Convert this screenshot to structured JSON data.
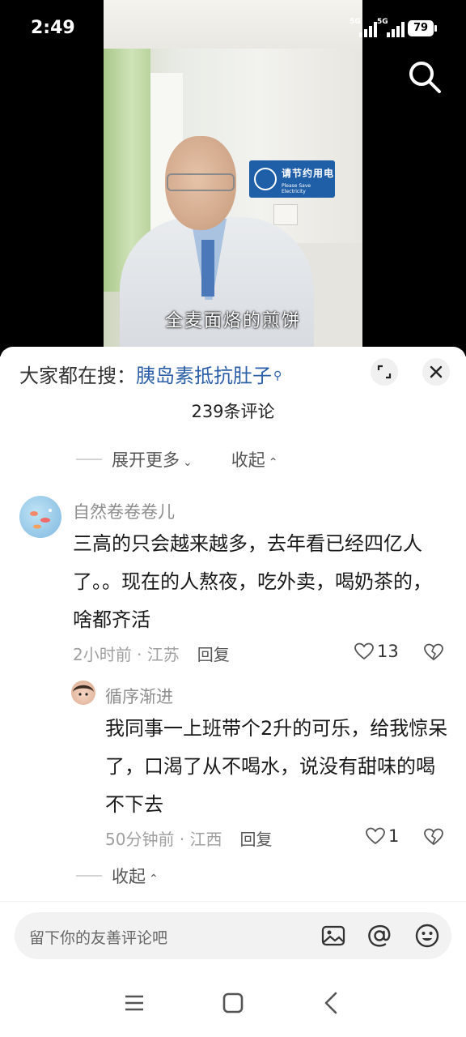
{
  "status_bar": {
    "time": "2:49",
    "network_1": "5G",
    "network_2": "5G",
    "battery": "79"
  },
  "video": {
    "caption": "全麦面烙的煎饼",
    "wall_sign_title": "请节约用电",
    "wall_sign_subtitle": "Please Save Electricity"
  },
  "comments_panel": {
    "hot_search_prefix": "大家都在搜：",
    "hot_search_term": "胰岛素抵抗肚子",
    "comment_count": "239条评论",
    "expand_more": "展开更多",
    "collapse_top": "收起",
    "collapse_bottom": "收起"
  },
  "comments": [
    {
      "username": "自然卷卷卷儿",
      "text": "三高的只会越来越多，去年看已经四亿人了。。现在的人熬夜，吃外卖，喝奶茶的，啥都齐活",
      "meta": "2小时前 · 江苏",
      "reply": "回复",
      "likes": "13"
    },
    {
      "username": "循序渐进",
      "text": "我同事一上班带个2升的可乐，给我惊呆了，口渴了从不喝水，说没有甜味的喝不下去",
      "meta": "50分钟前 · 江西",
      "reply": "回复",
      "likes": "1"
    }
  ],
  "input": {
    "placeholder": "留下你的友善评论吧"
  },
  "colors": {
    "link_blue": "#2b5fa8",
    "sign_blue": "#1f5fa8",
    "meta_gray": "#a0a0a0"
  },
  "icons": [
    "search-icon",
    "expand-icon",
    "close-icon",
    "heart-icon",
    "dislike-icon",
    "image-icon",
    "at-icon",
    "emoji-icon",
    "menu-icon",
    "home-icon",
    "back-icon"
  ]
}
